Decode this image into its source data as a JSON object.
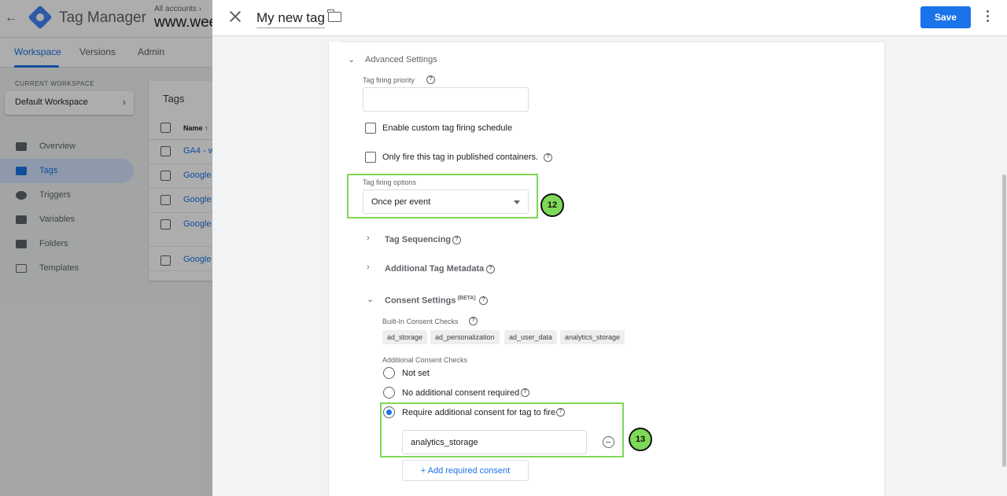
{
  "background": {
    "app_name": "Tag Manager",
    "breadcrumb": "All accounts",
    "container_name": "www.wee",
    "tabs": [
      {
        "label": "Workspace"
      },
      {
        "label": "Versions"
      },
      {
        "label": "Admin"
      }
    ],
    "current_workspace_label": "CURRENT WORKSPACE",
    "workspace_name": "Default Workspace",
    "nav": [
      {
        "label": "Overview"
      },
      {
        "label": "Tags"
      },
      {
        "label": "Triggers"
      },
      {
        "label": "Variables"
      },
      {
        "label": "Folders"
      },
      {
        "label": "Templates"
      }
    ],
    "tags_card_title": "Tags",
    "name_column_header": "Name",
    "rows": [
      "GA4 - w",
      "Google",
      "Google",
      "Google",
      "Google"
    ]
  },
  "panel": {
    "title": "My new tag",
    "save_label": "Save"
  },
  "advanced": {
    "title": "Advanced Settings",
    "priority_label": "Tag firing priority",
    "priority_value": "",
    "custom_schedule_label": "Enable custom tag firing schedule",
    "published_only_label": "Only fire this tag in published containers.",
    "firing_options_label": "Tag firing options",
    "firing_options_value": "Once per event",
    "sequencing_label": "Tag Sequencing",
    "metadata_label": "Additional Tag Metadata",
    "consent_label": "Consent Settings",
    "consent_beta": "(BETA)",
    "builtin_label": "Built-In Consent Checks",
    "builtin_chips": [
      "ad_storage",
      "ad_personalization",
      "ad_user_data",
      "analytics_storage"
    ],
    "additional_label": "Additional Consent Checks",
    "radio_options": [
      {
        "label": "Not set"
      },
      {
        "label": "No additional consent required"
      },
      {
        "label": "Require additional consent for tag to fire"
      }
    ],
    "required_consent_value": "analytics_storage",
    "add_consent_label": "+ Add required consent"
  },
  "annotations": {
    "step_12": "12",
    "step_13": "13"
  },
  "colors": {
    "accent": "#1a73e8",
    "highlight": "#7ed957"
  }
}
